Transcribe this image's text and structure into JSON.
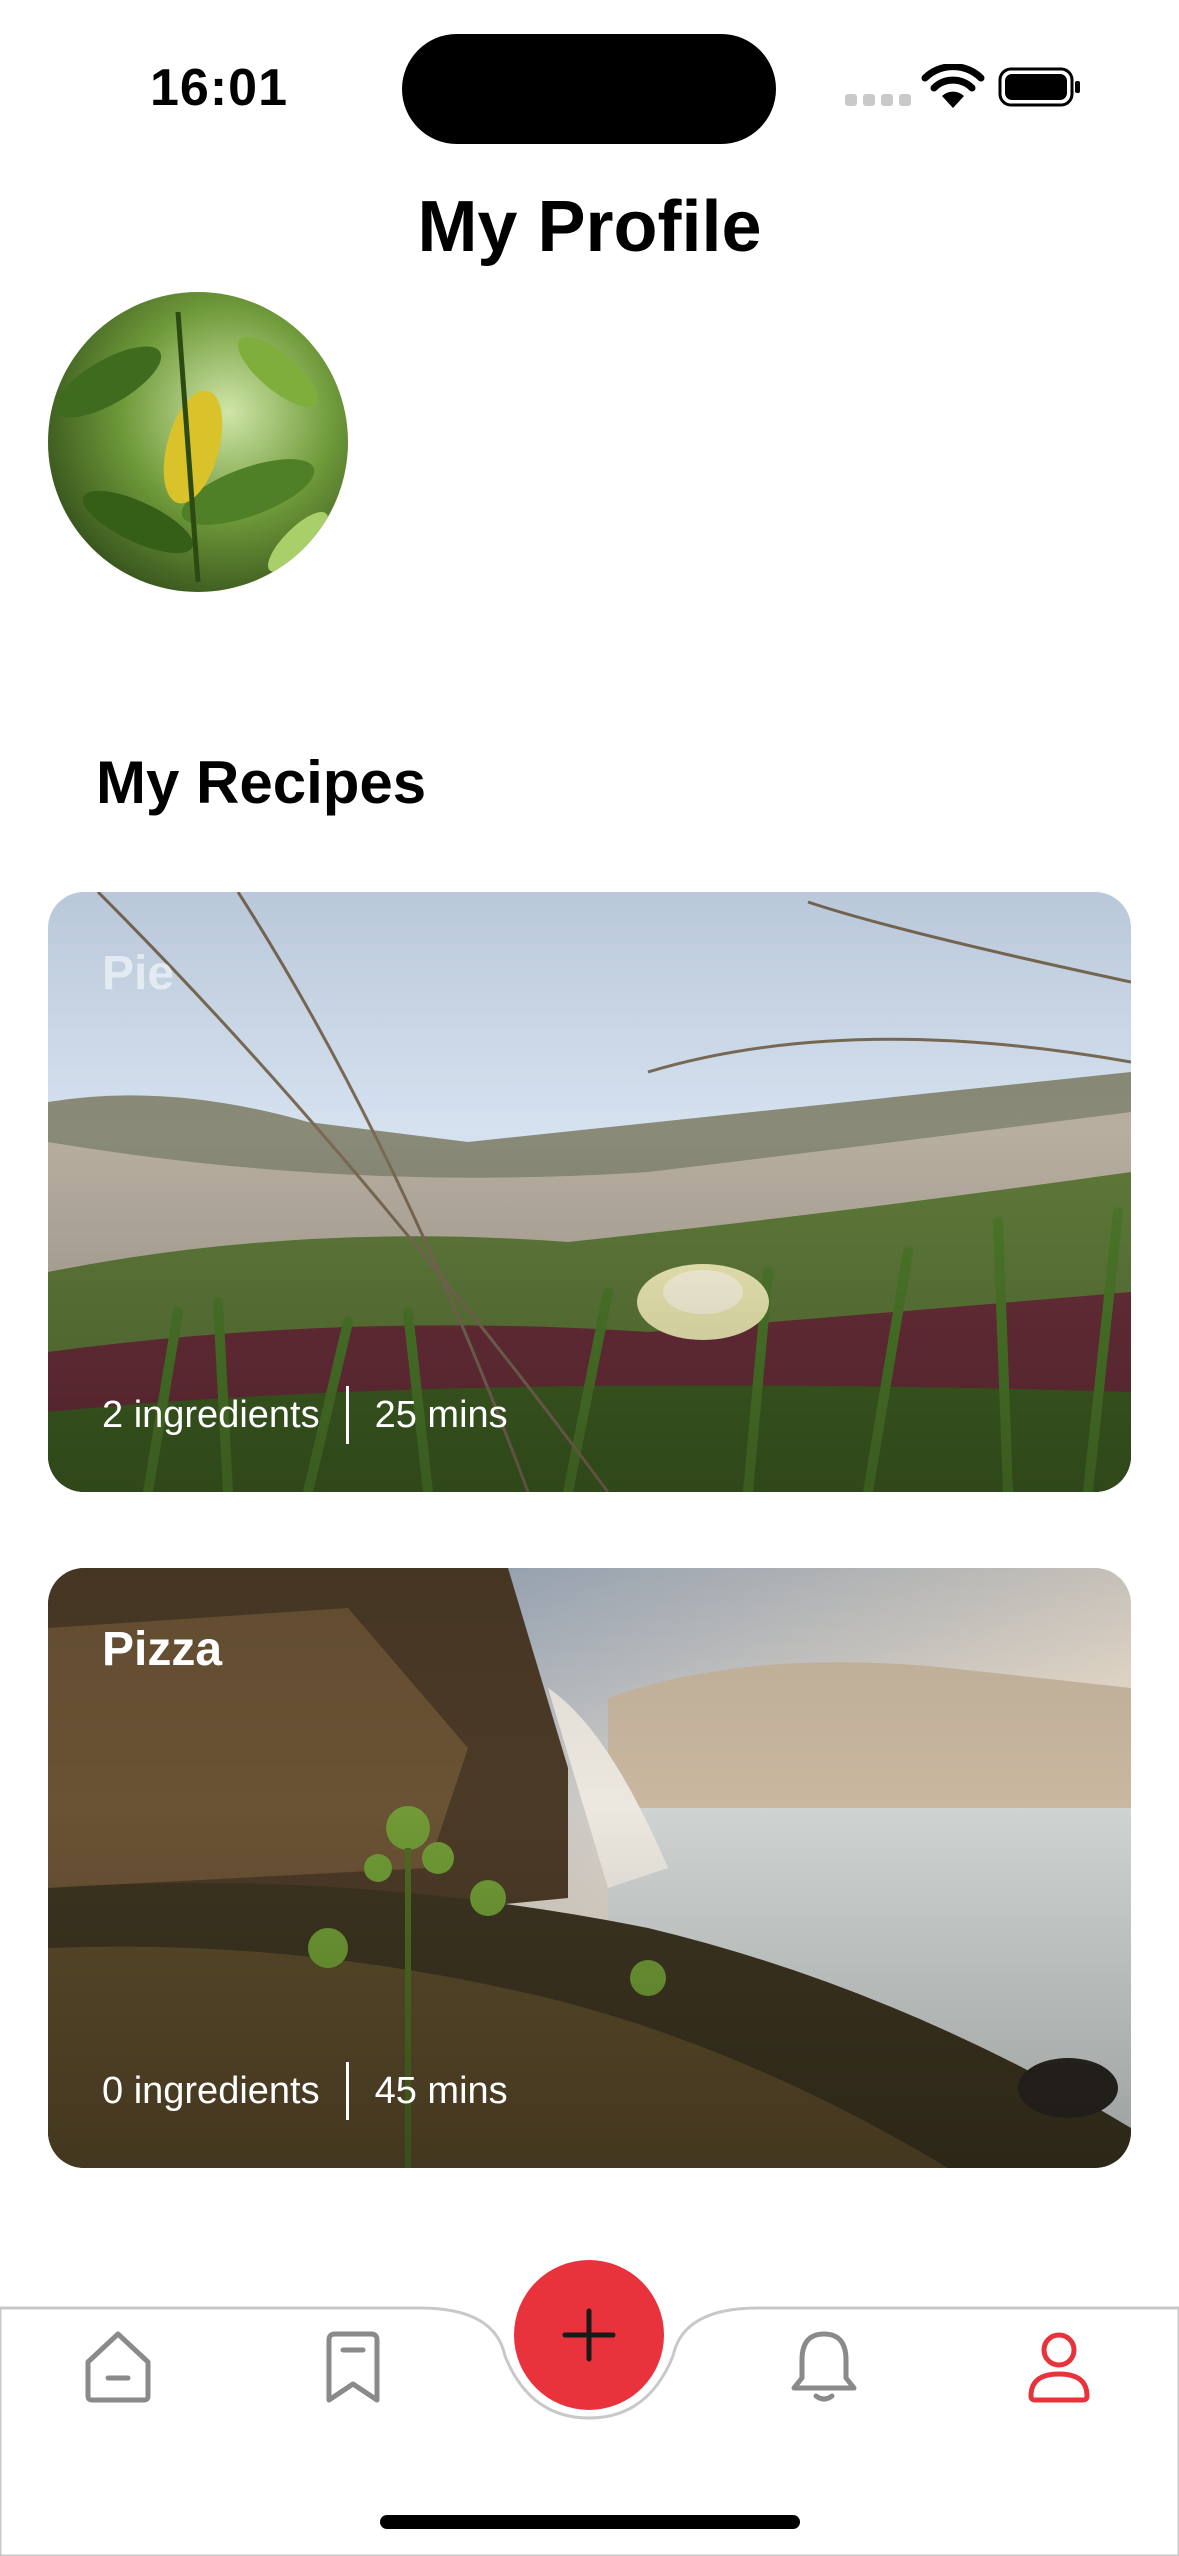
{
  "status_bar": {
    "time": "16:01"
  },
  "header": {
    "title": "My Profile"
  },
  "profile": {
    "avatar_icon": "profile-photo-leaf"
  },
  "recipes_section": {
    "title": "My Recipes",
    "items": [
      {
        "name": "Pie",
        "ingredients": "2 ingredients",
        "duration": "25 mins"
      },
      {
        "name": "Pizza",
        "ingredients": "0 ingredients",
        "duration": "45 mins"
      }
    ]
  },
  "tabbar": {
    "items": [
      {
        "icon": "home-icon",
        "active": false
      },
      {
        "icon": "bookmark-icon",
        "active": false
      },
      {
        "icon": "plus-icon",
        "active": false
      },
      {
        "icon": "bell-icon",
        "active": false
      },
      {
        "icon": "profile-icon",
        "active": true
      }
    ],
    "accent_color": "#e8323c",
    "inactive_color": "#8a8a8a"
  }
}
